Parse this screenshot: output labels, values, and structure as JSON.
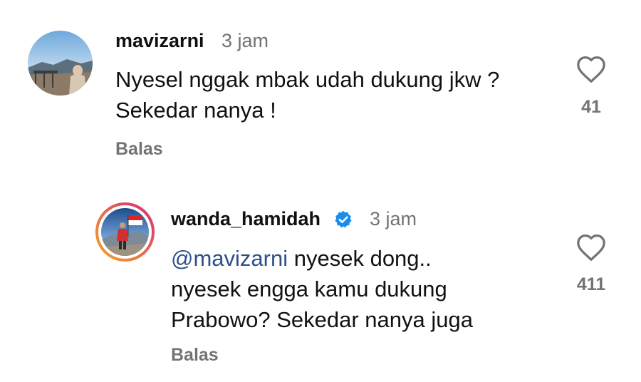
{
  "comments": [
    {
      "username": "mavizarni",
      "time": "3 jam",
      "text": "Nyesel nggak mbak udah dukung jkw ? Sekedar nanya !",
      "reply_label": "Balas",
      "like_count": "41"
    }
  ],
  "replies": [
    {
      "username": "wanda_hamidah",
      "verified": true,
      "time": "3 jam",
      "mention": "@mavizarni",
      "text": " nyesek dong.. nyesek engga kamu dukung Prabowo? Sekedar nanya juga",
      "reply_label": "Balas",
      "like_count": "411"
    }
  ],
  "colors": {
    "mention": "#2f4e8a",
    "muted": "#737373",
    "verified": "#1a8cf0",
    "story_ring_start": "#f9a825",
    "story_ring_end": "#d62976"
  }
}
